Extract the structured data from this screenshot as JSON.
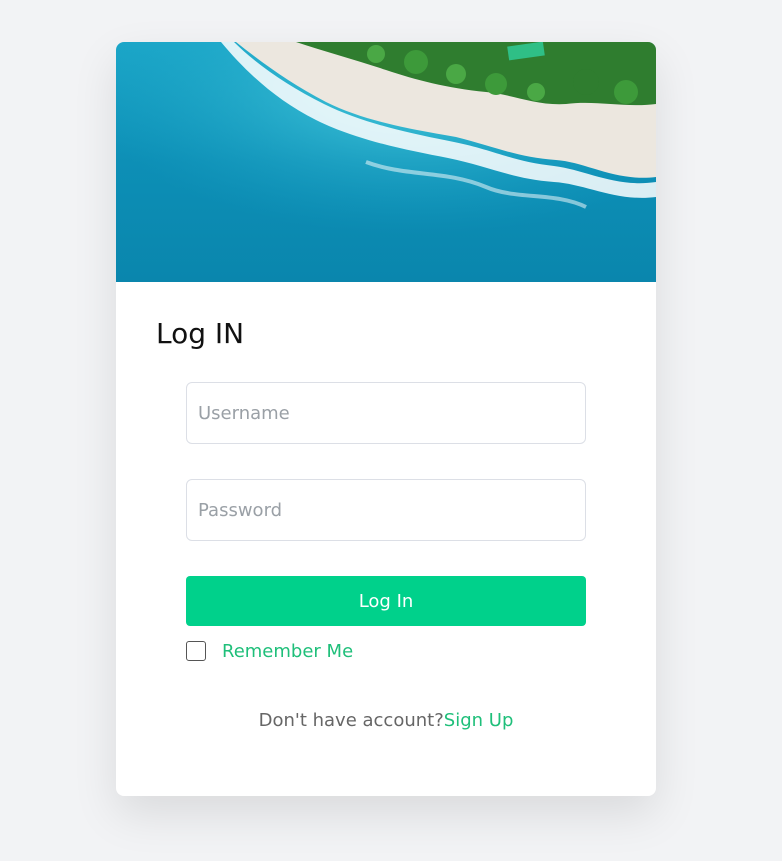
{
  "form": {
    "title": "Log IN",
    "username_placeholder": "Username",
    "password_placeholder": "Password",
    "login_label": "Log In",
    "remember_label": "Remember Me",
    "remember_checked": false,
    "signup_prompt": "Don't have account?",
    "signup_link": "Sign Up"
  },
  "colors": {
    "accent": "#00d18b",
    "link": "#1fbf7a",
    "page_background": "#f2f3f5"
  }
}
